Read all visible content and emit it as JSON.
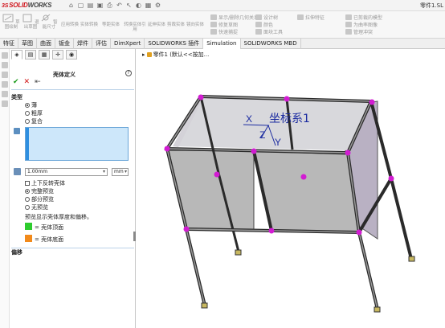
{
  "app": {
    "brand_prefix": "3S",
    "brand_main": "SOLID",
    "brand_tail": "WORKS",
    "doc_title": "零件1.SL"
  },
  "command_manager": {
    "big_buttons": [
      "草图绘制",
      "退出草图",
      "智能尺寸"
    ],
    "groups": [
      "应用转换",
      "实体转换",
      "等距实体",
      "转换实体引用",
      "延伸实体",
      "剪裁实体",
      "镜向实体",
      "线性草图阵列",
      "快速捕捉",
      "修复草图",
      "快速捕捉"
    ],
    "small_items": [
      "显示/删除几何关系",
      "修复草图",
      "快速捕捉",
      "设计树",
      "颜色",
      "面块工具",
      "拉伸特征",
      "已剪裁的模型",
      "为曲率图像",
      "管理冲突"
    ]
  },
  "tabs": [
    "特征",
    "草图",
    "曲面",
    "钣金",
    "焊件",
    "评估",
    "DimXpert",
    "SOLIDWORKS 插件",
    "Simulation",
    "SOLIDWORKS MBD"
  ],
  "active_tab": "Simulation",
  "property_manager": {
    "title": "壳体定义",
    "help": "?",
    "ok": "✔",
    "cancel": "✕",
    "pin": "⇤",
    "section_type": "类型",
    "type_options": [
      {
        "label": "薄",
        "selected": true
      },
      {
        "label": "粗厚",
        "selected": false
      },
      {
        "label": "复合",
        "selected": false
      }
    ],
    "thickness": "1.00mm",
    "unit": "mm",
    "flip_label": "上下反转壳体",
    "preview_options": [
      {
        "label": "完整预览",
        "selected": true
      },
      {
        "label": "部分预览",
        "selected": false
      },
      {
        "label": "无预览",
        "selected": false
      }
    ],
    "note": "预览显示壳体厚度和偏移。",
    "legend_top": "= 壳体顶面",
    "legend_bottom": "= 壳体底面",
    "legend_top_color": "#2ecc2e",
    "legend_bottom_color": "#f28a1b",
    "section_offset": "偏移"
  },
  "viewport": {
    "tree_label": "零件1 (默认<<按加...",
    "coord_label": "坐标系1",
    "axis_x": "X",
    "axis_y": "Y",
    "axis_z": "Z"
  }
}
